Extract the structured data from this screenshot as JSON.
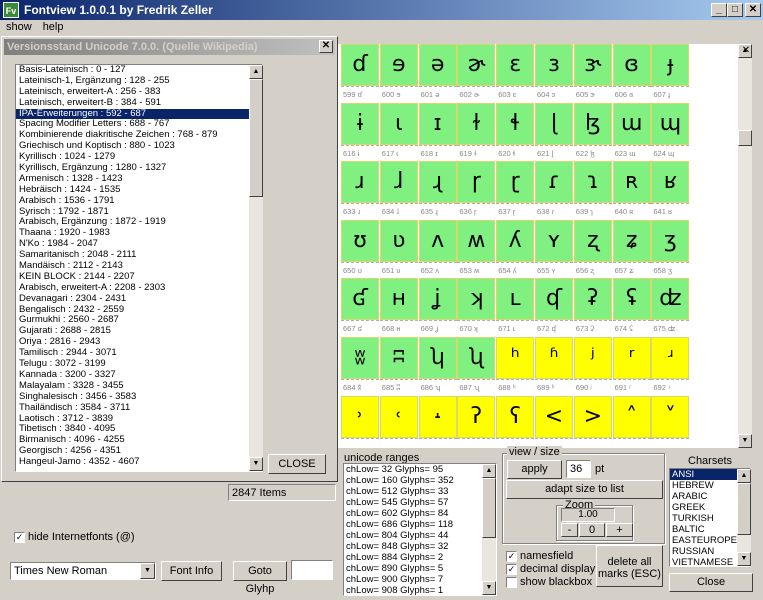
{
  "window": {
    "title": "Fontview 1.0.0.1 by Fredrik Zeller",
    "icon": "app-icon"
  },
  "menu": [
    {
      "label": "show"
    },
    {
      "label": "help"
    }
  ],
  "dialog": {
    "title": "Versionsstand Unicode 7.0.0. (Quelle Wikipedia)",
    "close_label": "CLOSE",
    "items": [
      "Basis-Lateinisch : 0 - 127",
      "Lateinisch-1, Ergänzung : 128 - 255",
      "Lateinisch, erweitert-A : 256 - 383",
      "Lateinisch, erweitert-B : 384 - 591",
      "IPA-Erweiterungen : 592 - 687",
      "Spacing Modifier Letters : 688 - 767",
      "Kombinierende diakritische Zeichen : 768 - 879",
      "Griechisch und Koptisch : 880 - 1023",
      "Kyrillisch : 1024 - 1279",
      "Kyrillisch, Ergänzung : 1280 - 1327",
      "Armenisch : 1328 - 1423",
      "Hebräisch : 1424 - 1535",
      "Arabisch : 1536 - 1791",
      "Syrisch : 1792 - 1871",
      "Arabisch, Ergänzung : 1872 - 1919",
      "Thaana : 1920 - 1983",
      "N'Ko : 1984 - 2047",
      "Samaritanisch : 2048 - 2111",
      "Mandäisch : 2112 - 2143",
      "KEIN BLOCK : 2144 - 2207",
      "Arabisch, erweitert-A : 2208 - 2303",
      "Devanagari : 2304 - 2431",
      "Bengalisch : 2432 - 2559",
      "Gurmukhi : 2560 - 2687",
      "Gujarati : 2688 - 2815",
      "Oriya : 2816 - 2943",
      "Tamilisch : 2944 - 3071",
      "Telugu : 3072 - 3199",
      "Kannada : 3200 - 3327",
      "Malayalam : 3328 - 3455",
      "Singhalesisch : 3456 - 3583",
      "Thailändisch : 3584 - 3711",
      "Laotisch : 3712 - 3839",
      "Tibetisch : 3840 - 4095",
      "Birmanisch : 4096 - 4255",
      "Georgisch : 4256 - 4351",
      "Hangeul-Jamo : 4352 - 4607"
    ],
    "selected_index": 4
  },
  "items_count": "2847 Items",
  "hide_internet_fonts": {
    "label": "hide Internetfonts (@)",
    "checked": "✓"
  },
  "font_select": {
    "value": "Times New Roman"
  },
  "font_info_label": "Font Info",
  "goto_glyph_label": "Goto Glyhp",
  "goto_glyph_value": "",
  "glyphs": {
    "rows": [
      {
        "color": "green",
        "cells": [
          {
            "g": "ɗ",
            "n": "599 ɗ"
          },
          {
            "g": "ɘ",
            "n": "600 ɘ"
          },
          {
            "g": "ə",
            "n": "601 ə"
          },
          {
            "g": "ɚ",
            "n": "602 ɚ"
          },
          {
            "g": "ɛ",
            "n": "603 ɛ"
          },
          {
            "g": "ɜ",
            "n": "604 ɜ"
          },
          {
            "g": "ɝ",
            "n": "605 ɝ"
          },
          {
            "g": "ɞ",
            "n": "606 ɞ"
          },
          {
            "g": "ɟ",
            "n": "607 ɟ"
          }
        ]
      },
      {
        "color": "green",
        "cells": [
          {
            "g": "ɨ",
            "n": "616 ɨ"
          },
          {
            "g": "ɩ",
            "n": "617 ɩ"
          },
          {
            "g": "ɪ",
            "n": "618 ɪ"
          },
          {
            "g": "ɫ",
            "n": "619 ɫ"
          },
          {
            "g": "ɬ",
            "n": "620 ɬ"
          },
          {
            "g": "ɭ",
            "n": "621 ɭ"
          },
          {
            "g": "ɮ",
            "n": "622 ɮ"
          },
          {
            "g": "ɯ",
            "n": "623 ɯ"
          },
          {
            "g": "ɰ",
            "n": "624 ɰ"
          }
        ]
      },
      {
        "color": "green",
        "cells": [
          {
            "g": "ɹ",
            "n": "633 ɹ"
          },
          {
            "g": "ɺ",
            "n": "634 ɺ"
          },
          {
            "g": "ɻ",
            "n": "635 ɻ"
          },
          {
            "g": "ɼ",
            "n": "636 ɼ"
          },
          {
            "g": "ɽ",
            "n": "637 ɽ"
          },
          {
            "g": "ɾ",
            "n": "638 ɾ"
          },
          {
            "g": "ɿ",
            "n": "639 ɿ"
          },
          {
            "g": "ʀ",
            "n": "640 ʀ"
          },
          {
            "g": "ʁ",
            "n": "641 ʁ"
          }
        ]
      },
      {
        "color": "green",
        "cells": [
          {
            "g": "ʊ",
            "n": "650 ʊ"
          },
          {
            "g": "ʋ",
            "n": "651 ʋ"
          },
          {
            "g": "ʌ",
            "n": "652 ʌ"
          },
          {
            "g": "ʍ",
            "n": "653 ʍ"
          },
          {
            "g": "ʎ",
            "n": "654 ʎ"
          },
          {
            "g": "ʏ",
            "n": "655 ʏ"
          },
          {
            "g": "ʐ",
            "n": "656 ʐ"
          },
          {
            "g": "ʑ",
            "n": "657 ʑ"
          },
          {
            "g": "ʒ",
            "n": "658 ʒ"
          }
        ]
      },
      {
        "color": "green",
        "cells": [
          {
            "g": "ʛ",
            "n": "667 ʛ"
          },
          {
            "g": "ʜ",
            "n": "668 ʜ"
          },
          {
            "g": "ʝ",
            "n": "669 ʝ"
          },
          {
            "g": "ʞ",
            "n": "670 ʞ"
          },
          {
            "g": "ʟ",
            "n": "671 ʟ"
          },
          {
            "g": "ʠ",
            "n": "672 ʠ"
          },
          {
            "g": "ʡ",
            "n": "673 ʡ"
          },
          {
            "g": "ʢ",
            "n": "674 ʢ"
          },
          {
            "g": "ʣ",
            "n": "675 ʣ"
          }
        ]
      },
      {
        "color": "mixed",
        "cells": [
          {
            "g": "ʬ",
            "n": "684 ʬ",
            "c": "green"
          },
          {
            "g": "ʭ",
            "n": "685 ʭ",
            "c": "green"
          },
          {
            "g": "ʮ",
            "n": "686 ʮ",
            "c": "green"
          },
          {
            "g": "ʯ",
            "n": "687 ʯ",
            "c": "green"
          },
          {
            "g": "ʰ",
            "n": "688 ʰ",
            "c": "yellow"
          },
          {
            "g": "ʱ",
            "n": "689 ʱ",
            "c": "yellow"
          },
          {
            "g": "ʲ",
            "n": "690 ʲ",
            "c": "yellow"
          },
          {
            "g": "ʳ",
            "n": "691 ʳ",
            "c": "yellow"
          },
          {
            "g": "ʴ",
            "n": "692 ʴ",
            "c": "yellow"
          }
        ]
      },
      {
        "color": "yellow",
        "cells": [
          {
            "g": "˒",
            "n": ""
          },
          {
            "g": "˓",
            "n": ""
          },
          {
            "g": "˔",
            "n": ""
          },
          {
            "g": "ʔ",
            "n": ""
          },
          {
            "g": "ʕ",
            "n": ""
          },
          {
            "g": "<",
            "n": ""
          },
          {
            "g": ">",
            "n": ""
          },
          {
            "g": "˄",
            "n": ""
          },
          {
            "g": "˅",
            "n": ""
          }
        ]
      }
    ]
  },
  "unicode_ranges": {
    "label": "unicode ranges",
    "items": [
      "chLow= 32  Glyphs= 95",
      "chLow= 160  Glyphs= 352",
      "chLow= 512  Glyphs= 33",
      "chLow= 545  Glyphs= 57",
      "chLow= 602  Glyphs= 84",
      "chLow= 686  Glyphs= 118",
      "chLow= 804  Glyphs= 44",
      "chLow= 848  Glyphs= 32",
      "chLow= 884  Glyphs= 2",
      "chLow= 890  Glyphs= 5",
      "chLow= 900  Glyphs= 7",
      "chLow= 908  Glyphs= 1"
    ]
  },
  "view_size": {
    "label": "view / size",
    "apply_label": "apply",
    "size_value": "36",
    "size_unit": "pt",
    "adapt_label": "adapt size to list",
    "zoom_label": "Zoom",
    "zoom_value": "1.00",
    "minus_label": "-",
    "zero_label": "0",
    "plus_label": "+"
  },
  "options": {
    "namesfield": {
      "label": "namesfield",
      "checked": "✓"
    },
    "decimal": {
      "label": "decimal display",
      "checked": "✓"
    },
    "blackbox": {
      "label": "show blackbox",
      "checked": ""
    }
  },
  "delete_marks_label": "delete all marks (ESC)",
  "charsets": {
    "label": "Charsets",
    "items": [
      "ANSI",
      "HEBREW",
      "ARABIC",
      "GREEK",
      "TURKISH",
      "BALTIC",
      "EASTEUROPE",
      "RUSSIAN",
      "VIETNAMESE"
    ],
    "selected_index": 0
  },
  "close_label": "Close"
}
